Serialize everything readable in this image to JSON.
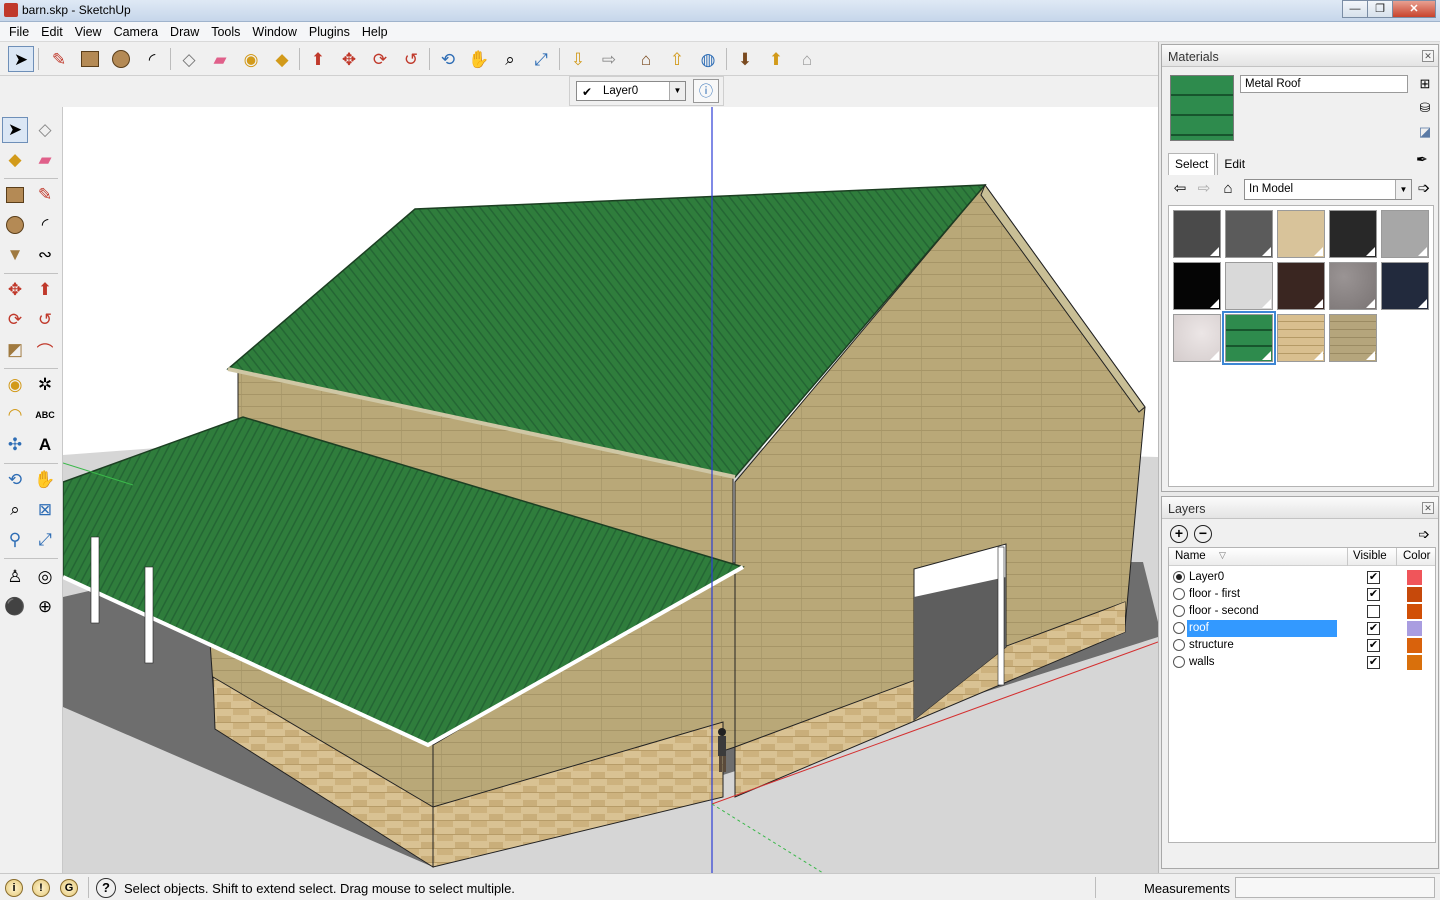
{
  "window": {
    "title": "barn.skp - SketchUp",
    "buttons": [
      "—",
      "❐",
      "✕"
    ]
  },
  "menu": [
    "File",
    "Edit",
    "View",
    "Camera",
    "Draw",
    "Tools",
    "Window",
    "Plugins",
    "Help"
  ],
  "layer_toolbar": {
    "current_layer": "Layer0"
  },
  "status": {
    "message": "Select objects. Shift to extend select. Drag mouse to select multiple.",
    "measurements_label": "Measurements",
    "measurements_value": ""
  },
  "materials": {
    "panel_title": "Materials",
    "current_name": "Metal Roof",
    "tabs": [
      "Select",
      "Edit"
    ],
    "collection": "In Model",
    "swatches": [
      {
        "name": "dark-gray",
        "color": "#4a4a4a"
      },
      {
        "name": "mid-gray",
        "color": "#5b5b5b"
      },
      {
        "name": "tan",
        "color": "#d8c39a"
      },
      {
        "name": "charcoal",
        "color": "#282828"
      },
      {
        "name": "light-gray",
        "color": "#a7a7a7"
      },
      {
        "name": "black",
        "color": "#050505"
      },
      {
        "name": "pale-gray",
        "color": "#d9d9d9"
      },
      {
        "name": "dark-brown",
        "color": "#3a2621"
      },
      {
        "name": "granite",
        "color": "#8a8585"
      },
      {
        "name": "navy",
        "color": "#222a3d"
      },
      {
        "name": "white-stucco",
        "color": "#e2dcdc"
      },
      {
        "name": "metal-roof",
        "color": "#2e8b4d"
      },
      {
        "name": "sandstone-brick",
        "color": "#d9bf8f"
      },
      {
        "name": "khaki-brick",
        "color": "#b5a57c"
      }
    ]
  },
  "layers": {
    "panel_title": "Layers",
    "columns": {
      "name": "Name",
      "visible": "Visible",
      "color": "Color"
    },
    "rows": [
      {
        "name": "Layer0",
        "active": true,
        "visible": true,
        "color": "#f0555a",
        "selected": false
      },
      {
        "name": "floor - first",
        "active": false,
        "visible": true,
        "color": "#c6490b",
        "selected": false
      },
      {
        "name": "floor - second",
        "active": false,
        "visible": false,
        "color": "#d14f06",
        "selected": false
      },
      {
        "name": "roof",
        "active": false,
        "visible": true,
        "color": "#a99de0",
        "selected": true
      },
      {
        "name": "structure",
        "active": false,
        "visible": true,
        "color": "#d9620c",
        "selected": false
      },
      {
        "name": "walls",
        "active": false,
        "visible": true,
        "color": "#d9700c",
        "selected": false
      }
    ]
  },
  "colors": {
    "roof_green": "#2f7d3c",
    "roof_green_dark": "#236331",
    "wall_tan": "#b9a878",
    "stone_tan": "#d6bf8f",
    "ground": "#d6d6d6",
    "sky": "#ffffff",
    "axis_blue": "#2d3dd6",
    "axis_red": "#d43030",
    "axis_green": "#3ab84a"
  }
}
